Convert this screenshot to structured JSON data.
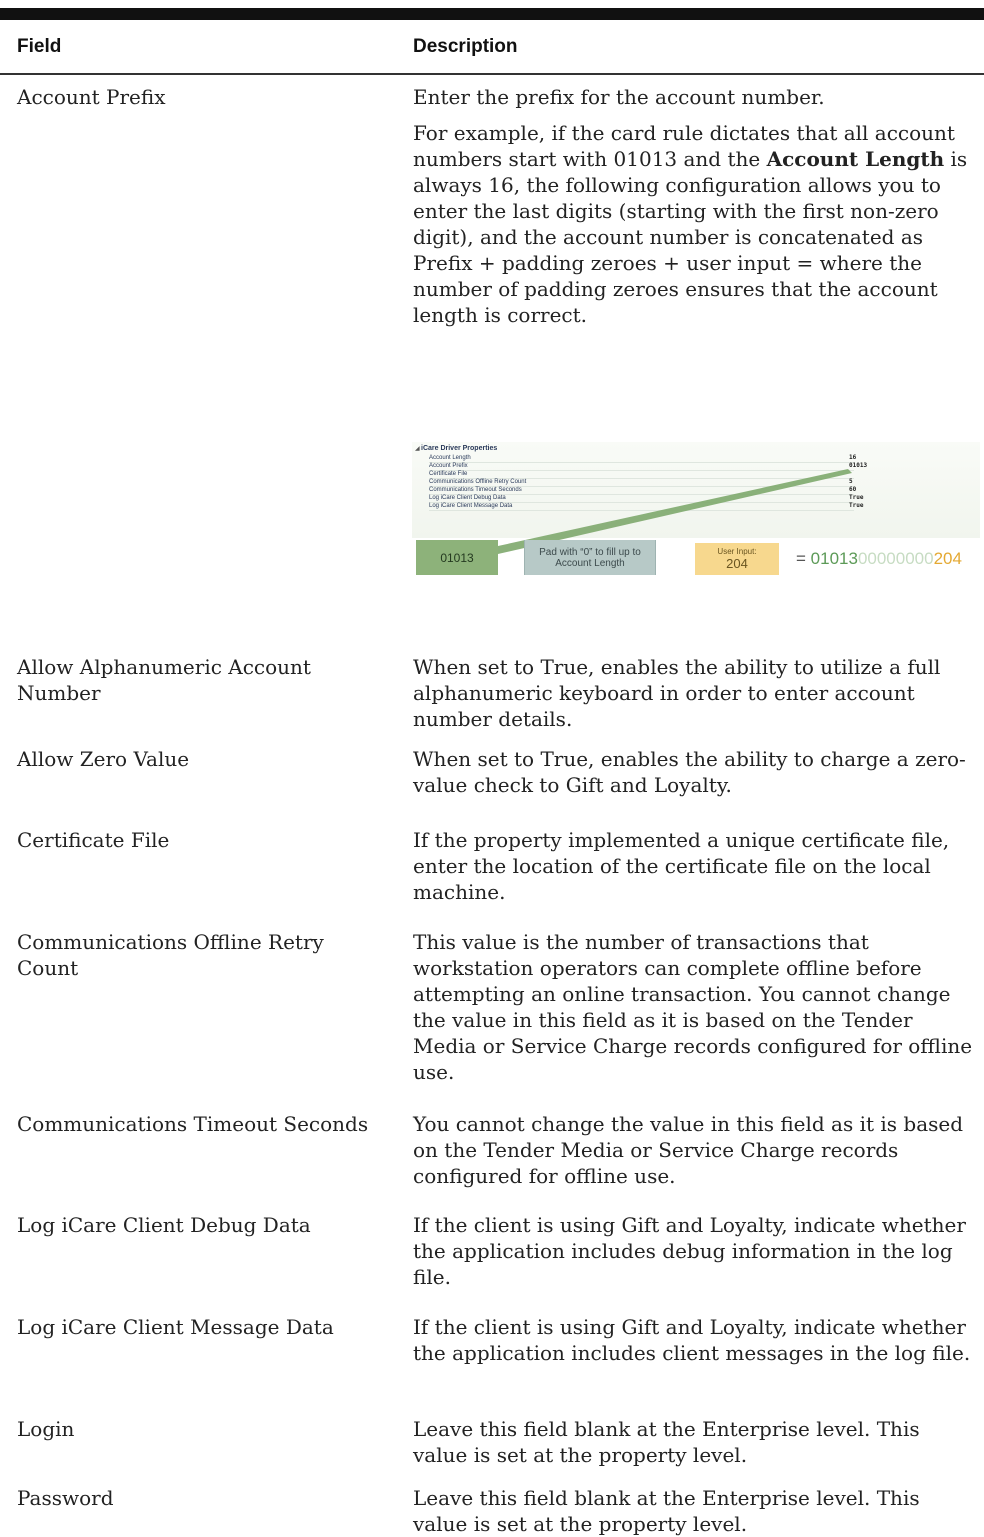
{
  "table": {
    "header": {
      "field": "Field",
      "description": "Description"
    },
    "rows": [
      {
        "field": "Account Prefix",
        "description": "Enter the prefix for the account number.",
        "description_example_1": "For example, if the card rule dictates that all account numbers start with 01013 and the",
        "description_example_bold": "Account Length",
        "description_example_2": " is always 16, the following configuration allows you to enter the last digits (starting with the first non-zero digit), and the account number is concatenated as Prefix + padding zeroes + user input = where the number of padding zeroes ensures that the account length is correct."
      },
      {
        "field": "Allow Alphanumeric Account Number",
        "description": "When set to True, enables the ability to utilize a full alphanumeric keyboard in order to enter account number details."
      },
      {
        "field": "Allow Zero Value",
        "description": "When set to True, enables the ability to charge a zero-value check to Gift and Loyalty."
      },
      {
        "field": "Certificate File",
        "description": "If the property implemented a unique certificate file, enter the location of the certificate file on the local machine."
      },
      {
        "field": "Communications Offline Retry Count",
        "description": "This value is the number of transactions that workstation operators can complete offline before attempting an online transaction. You cannot change the value in this field as it is based on the Tender Media or Service Charge records configured for offline use."
      },
      {
        "field": "Communications Timeout Seconds",
        "description": "You cannot change the value in this field as it is based on the Tender Media or Service Charge records configured for offline use."
      },
      {
        "field": "Log iCare Client Debug Data",
        "description": "If the client is using Gift and Loyalty, indicate whether the application includes debug information in the log file."
      },
      {
        "field": "Log iCare Client Message Data",
        "description": "If the client is using Gift and Loyalty, indicate whether the application includes client messages in the log file."
      },
      {
        "field": "Login",
        "description": "Leave this field blank at the Enterprise level. This value is set at the property level."
      },
      {
        "field": "Password",
        "description": "Leave this field blank at the Enterprise level. This value is set at the property level."
      }
    ]
  },
  "figure": {
    "title": "iCare Driver Properties",
    "properties": [
      {
        "name": "Account Length",
        "value": "16"
      },
      {
        "name": "Account Prefix",
        "value": "01013"
      },
      {
        "name": "Certificate File",
        "value": ""
      },
      {
        "name": "Communications Offline Retry Count",
        "value": "5"
      },
      {
        "name": "Communications Timeout Seconds",
        "value": "60"
      },
      {
        "name": "Log iCare Client Debug Data",
        "value": "True"
      },
      {
        "name": "Log iCare Client Message Data",
        "value": "True"
      }
    ],
    "prefix_box": "01013",
    "pad_box": "Pad with “0” to fill up to Account Length",
    "user_input_label": "User Input:",
    "user_input_value": "204",
    "result_eq": "= ",
    "result_prefix": "01013",
    "result_zeros": "00000000",
    "result_user": "204",
    "colors": {
      "prefix": "#8db27a",
      "pad": "#b7c9c7",
      "user": "#f7d88e",
      "line": "#6a9a5c"
    }
  }
}
